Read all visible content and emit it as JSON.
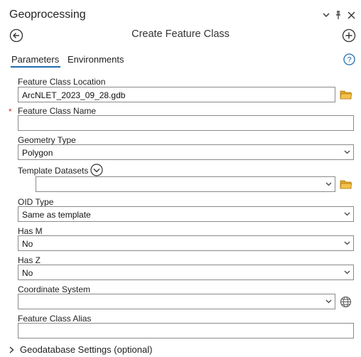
{
  "pane": {
    "title": "Geoprocessing",
    "window_icons": [
      "dropdown-icon",
      "pin-icon",
      "close-icon"
    ]
  },
  "tool": {
    "title": "Create Feature Class",
    "back_icon": "back-arrow-icon",
    "add_icon": "add-circle-icon"
  },
  "tabs": [
    {
      "label": "Parameters",
      "active": true
    },
    {
      "label": "Environments",
      "active": false
    }
  ],
  "help_label": "?",
  "params": {
    "location": {
      "label": "Feature Class Location",
      "value": "ArcNLET_2023_09_28.gdb"
    },
    "name": {
      "label": "Feature Class Name",
      "value": "",
      "required_mark": "*"
    },
    "geometry": {
      "label": "Geometry Type",
      "value": "Polygon"
    },
    "template": {
      "label": "Template Datasets",
      "value": ""
    },
    "oid": {
      "label": "OID Type",
      "value": "Same as template"
    },
    "has_m": {
      "label": "Has M",
      "value": "No"
    },
    "has_z": {
      "label": "Has Z",
      "value": "No"
    },
    "coord": {
      "label": "Coordinate System",
      "value": ""
    },
    "alias": {
      "label": "Feature Class Alias",
      "value": ""
    }
  },
  "section": {
    "label": "Geodatabase Settings (optional)"
  },
  "colors": {
    "accent": "#1f6cb0",
    "required": "#c0392b",
    "folder": "#e0a526"
  }
}
